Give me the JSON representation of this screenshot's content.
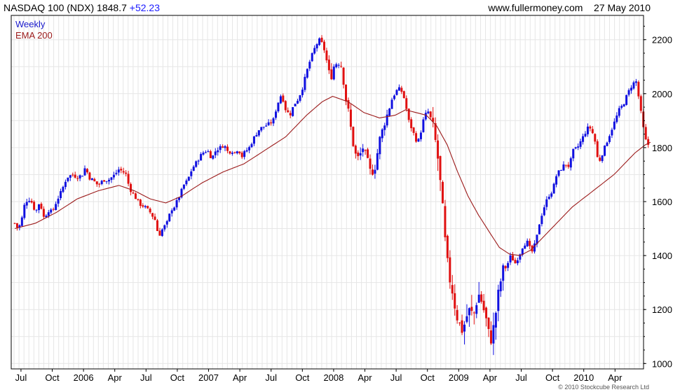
{
  "header": {
    "symbol": "NASDAQ 100 (NDX)",
    "price": "1848.7",
    "change": "+52.23",
    "site": "www.fullermoney.com",
    "date": "27 May 2010"
  },
  "legend": {
    "weekly": "Weekly",
    "ema": "EMA 200"
  },
  "copyright": "© 2010 Stockcube Research Ltd",
  "colors": {
    "up": "#1010e0",
    "down": "#e01010",
    "ema": "#9b1a1a",
    "grid": "#e6e6e6",
    "frame": "#000000"
  },
  "chart_data": {
    "type": "candlestick",
    "series_names": [
      "Weekly",
      "EMA 200"
    ],
    "ylim": [
      980,
      2290
    ],
    "y_ticks": [
      1000,
      1200,
      1400,
      1600,
      1800,
      2000,
      2200
    ],
    "x_ticks": [
      {
        "label": "Jul",
        "t": 0.6
      },
      {
        "label": "Oct",
        "t": 3.6
      },
      {
        "label": "2006",
        "t": 6.6
      },
      {
        "label": "Apr",
        "t": 9.6
      },
      {
        "label": "Jul",
        "t": 12.6
      },
      {
        "label": "Oct",
        "t": 15.6
      },
      {
        "label": "2007",
        "t": 18.6
      },
      {
        "label": "Apr",
        "t": 21.6
      },
      {
        "label": "Jul",
        "t": 24.6
      },
      {
        "label": "Oct",
        "t": 27.6
      },
      {
        "label": "2008",
        "t": 30.6
      },
      {
        "label": "Apr",
        "t": 33.6
      },
      {
        "label": "Jul",
        "t": 36.6
      },
      {
        "label": "Oct",
        "t": 39.6
      },
      {
        "label": "2009",
        "t": 42.6
      },
      {
        "label": "Apr",
        "t": 45.6
      },
      {
        "label": "Jul",
        "t": 48.6
      },
      {
        "label": "Oct",
        "t": 51.6
      },
      {
        "label": "2010",
        "t": 54.6
      },
      {
        "label": "Apr",
        "t": 57.6
      }
    ],
    "x_range": [
      0,
      60
    ],
    "price_path": [
      [
        0.0,
        1520
      ],
      [
        0.3,
        1500
      ],
      [
        0.6,
        1520
      ],
      [
        1.0,
        1600
      ],
      [
        1.5,
        1610
      ],
      [
        2.0,
        1560
      ],
      [
        2.4,
        1600
      ],
      [
        2.8,
        1540
      ],
      [
        3.3,
        1570
      ],
      [
        3.6,
        1560
      ],
      [
        4.0,
        1600
      ],
      [
        4.5,
        1640
      ],
      [
        5.0,
        1690
      ],
      [
        5.5,
        1700
      ],
      [
        6.0,
        1690
      ],
      [
        6.5,
        1700
      ],
      [
        6.8,
        1730
      ],
      [
        7.1,
        1690
      ],
      [
        7.5,
        1680
      ],
      [
        8.0,
        1660
      ],
      [
        8.5,
        1680
      ],
      [
        9.0,
        1680
      ],
      [
        9.6,
        1700
      ],
      [
        10.0,
        1720
      ],
      [
        10.4,
        1710
      ],
      [
        10.7,
        1700
      ],
      [
        11.0,
        1650
      ],
      [
        11.5,
        1620
      ],
      [
        12.0,
        1590
      ],
      [
        12.5,
        1580
      ],
      [
        13.0,
        1560
      ],
      [
        13.5,
        1530
      ],
      [
        13.8,
        1470
      ],
      [
        14.2,
        1500
      ],
      [
        14.6,
        1520
      ],
      [
        15.0,
        1570
      ],
      [
        15.3,
        1580
      ],
      [
        15.8,
        1620
      ],
      [
        16.2,
        1660
      ],
      [
        16.6,
        1680
      ],
      [
        17.0,
        1720
      ],
      [
        17.5,
        1750
      ],
      [
        18.0,
        1780
      ],
      [
        18.5,
        1790
      ],
      [
        18.9,
        1760
      ],
      [
        19.3,
        1790
      ],
      [
        19.7,
        1800
      ],
      [
        20.1,
        1810
      ],
      [
        20.5,
        1780
      ],
      [
        20.8,
        1790
      ],
      [
        21.1,
        1780
      ],
      [
        21.5,
        1800
      ],
      [
        21.7,
        1760
      ],
      [
        22.0,
        1780
      ],
      [
        22.5,
        1800
      ],
      [
        23.0,
        1840
      ],
      [
        23.5,
        1870
      ],
      [
        24.0,
        1880
      ],
      [
        24.5,
        1890
      ],
      [
        24.8,
        1900
      ],
      [
        25.2,
        1960
      ],
      [
        25.6,
        2000
      ],
      [
        26.0,
        1940
      ],
      [
        26.4,
        1920
      ],
      [
        26.8,
        1960
      ],
      [
        27.2,
        1980
      ],
      [
        27.6,
        2020
      ],
      [
        28.0,
        2080
      ],
      [
        28.4,
        2130
      ],
      [
        28.8,
        2170
      ],
      [
        29.2,
        2200
      ],
      [
        29.6,
        2180
      ],
      [
        30.0,
        2110
      ],
      [
        30.3,
        2050
      ],
      [
        30.6,
        2100
      ],
      [
        31.0,
        2120
      ],
      [
        31.4,
        2100
      ],
      [
        31.7,
        1990
      ],
      [
        32.0,
        1940
      ],
      [
        32.3,
        1860
      ],
      [
        32.6,
        1780
      ],
      [
        33.0,
        1760
      ],
      [
        33.4,
        1800
      ],
      [
        33.8,
        1760
      ],
      [
        34.2,
        1700
      ],
      [
        34.6,
        1730
      ],
      [
        35.0,
        1830
      ],
      [
        35.4,
        1880
      ],
      [
        35.8,
        1930
      ],
      [
        36.2,
        1980
      ],
      [
        36.6,
        2010
      ],
      [
        37.0,
        2020
      ],
      [
        37.4,
        1980
      ],
      [
        37.8,
        1900
      ],
      [
        38.2,
        1860
      ],
      [
        38.6,
        1820
      ],
      [
        38.8,
        1830
      ],
      [
        39.2,
        1900
      ],
      [
        39.6,
        1940
      ],
      [
        40.0,
        1900
      ],
      [
        40.3,
        1840
      ],
      [
        40.6,
        1760
      ],
      [
        41.0,
        1600
      ],
      [
        41.3,
        1450
      ],
      [
        41.6,
        1340
      ],
      [
        42.0,
        1270
      ],
      [
        42.3,
        1200
      ],
      [
        42.6,
        1150
      ],
      [
        43.0,
        1120
      ],
      [
        43.3,
        1170
      ],
      [
        43.7,
        1200
      ],
      [
        44.0,
        1170
      ],
      [
        44.3,
        1230
      ],
      [
        44.6,
        1260
      ],
      [
        45.0,
        1200
      ],
      [
        45.3,
        1150
      ],
      [
        45.6,
        1080
      ],
      [
        45.9,
        1120
      ],
      [
        46.2,
        1200
      ],
      [
        46.5,
        1280
      ],
      [
        46.8,
        1340
      ],
      [
        47.2,
        1360
      ],
      [
        47.6,
        1400
      ],
      [
        48.0,
        1370
      ],
      [
        48.4,
        1400
      ],
      [
        48.8,
        1440
      ],
      [
        49.2,
        1450
      ],
      [
        49.6,
        1410
      ],
      [
        50.0,
        1450
      ],
      [
        50.4,
        1530
      ],
      [
        50.8,
        1580
      ],
      [
        51.2,
        1620
      ],
      [
        51.6,
        1640
      ],
      [
        52.0,
        1700
      ],
      [
        52.4,
        1720
      ],
      [
        52.8,
        1740
      ],
      [
        53.2,
        1730
      ],
      [
        53.6,
        1790
      ],
      [
        54.0,
        1800
      ],
      [
        54.4,
        1830
      ],
      [
        54.8,
        1860
      ],
      [
        55.1,
        1880
      ],
      [
        55.4,
        1860
      ],
      [
        55.7,
        1820
      ],
      [
        56.0,
        1740
      ],
      [
        56.4,
        1780
      ],
      [
        56.8,
        1820
      ],
      [
        57.2,
        1860
      ],
      [
        57.6,
        1900
      ],
      [
        58.0,
        1940
      ],
      [
        58.4,
        1960
      ],
      [
        58.8,
        2000
      ],
      [
        59.2,
        2030
      ],
      [
        59.6,
        2050
      ],
      [
        59.9,
        1980
      ],
      [
        60.2,
        1900
      ],
      [
        60.5,
        1830
      ],
      [
        60.8,
        1810
      ],
      [
        61.0,
        1848.7
      ]
    ],
    "ema_path": [
      [
        0.0,
        1500
      ],
      [
        2.0,
        1520
      ],
      [
        4.0,
        1560
      ],
      [
        6.0,
        1610
      ],
      [
        8.0,
        1640
      ],
      [
        10.0,
        1660
      ],
      [
        11.5,
        1640
      ],
      [
        13.0,
        1610
      ],
      [
        14.5,
        1595
      ],
      [
        16.0,
        1620
      ],
      [
        18.0,
        1670
      ],
      [
        20.0,
        1710
      ],
      [
        22.0,
        1740
      ],
      [
        24.0,
        1790
      ],
      [
        26.0,
        1840
      ],
      [
        28.0,
        1920
      ],
      [
        29.5,
        1970
      ],
      [
        30.5,
        1990
      ],
      [
        32.0,
        1970
      ],
      [
        33.5,
        1930
      ],
      [
        35.0,
        1910
      ],
      [
        36.5,
        1920
      ],
      [
        37.5,
        1940
      ],
      [
        38.5,
        1930
      ],
      [
        39.5,
        1920
      ],
      [
        40.5,
        1880
      ],
      [
        41.5,
        1810
      ],
      [
        42.5,
        1710
      ],
      [
        43.5,
        1620
      ],
      [
        44.5,
        1550
      ],
      [
        45.5,
        1490
      ],
      [
        46.5,
        1430
      ],
      [
        47.5,
        1405
      ],
      [
        48.5,
        1400
      ],
      [
        49.5,
        1420
      ],
      [
        50.5,
        1460
      ],
      [
        51.5,
        1500
      ],
      [
        52.5,
        1540
      ],
      [
        53.5,
        1580
      ],
      [
        54.5,
        1610
      ],
      [
        55.5,
        1640
      ],
      [
        56.5,
        1670
      ],
      [
        57.5,
        1700
      ],
      [
        58.5,
        1740
      ],
      [
        59.5,
        1780
      ],
      [
        60.5,
        1810
      ],
      [
        61.0,
        1820
      ]
    ]
  }
}
